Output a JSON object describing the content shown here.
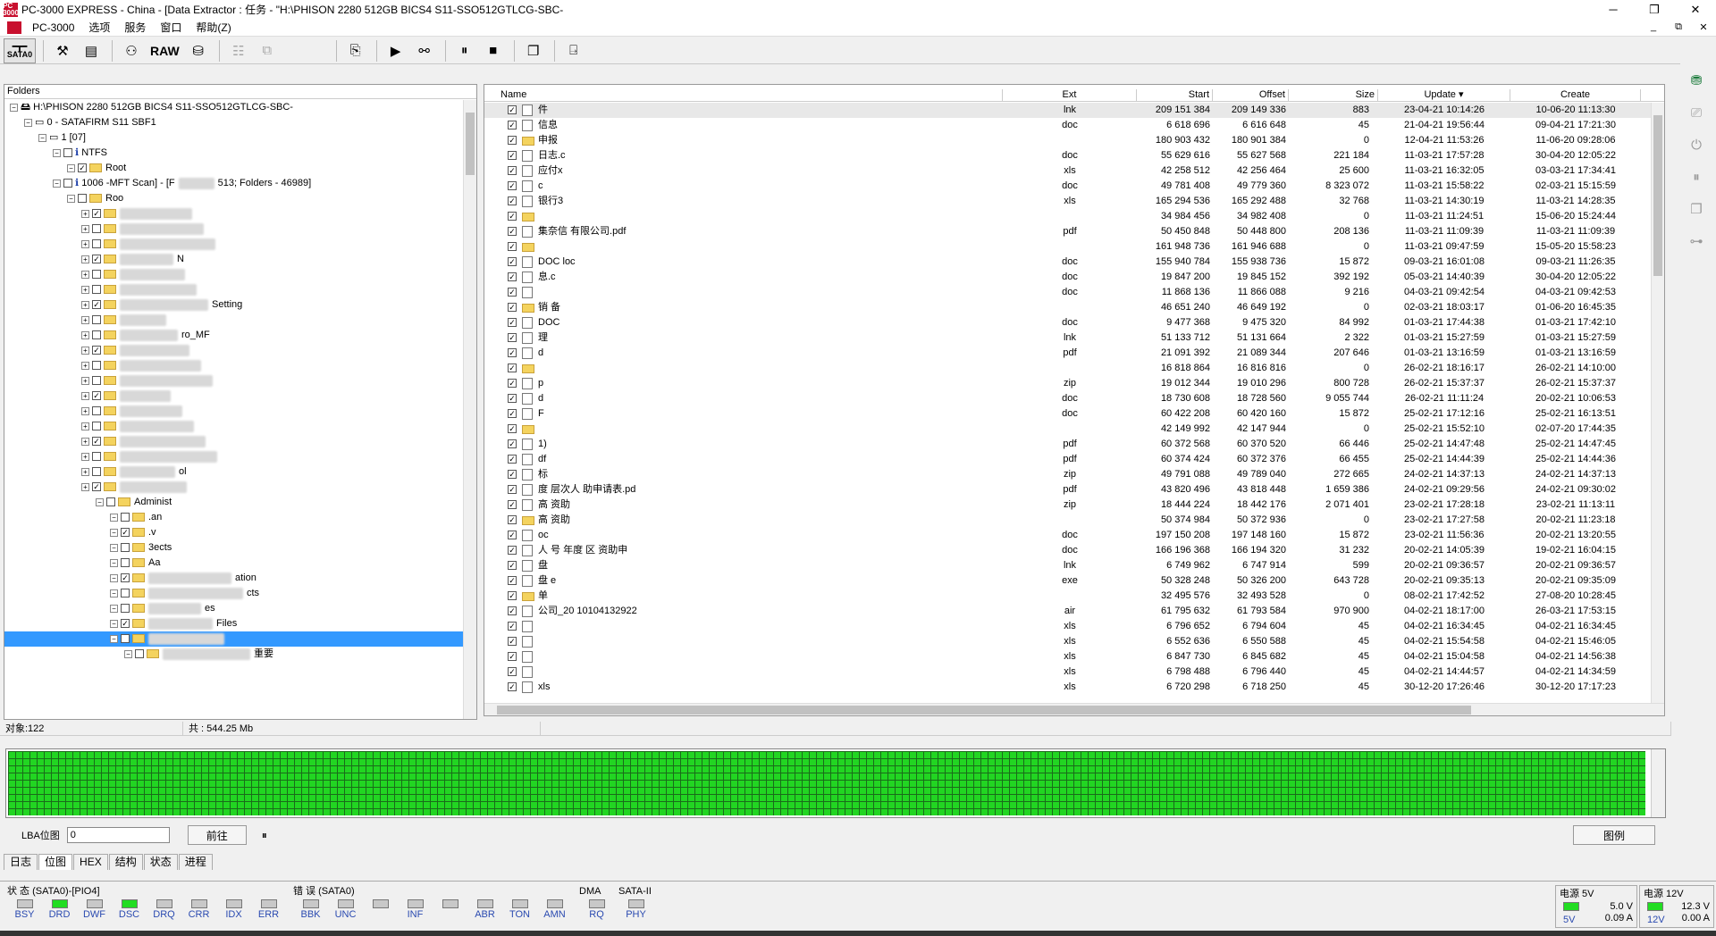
{
  "window": {
    "logo_text": "PC 3000",
    "title": "PC-3000 EXPRESS - China - [Data Extractor : 任务 - \"H:\\PHISON 2280 512GB BICS4 S11-SSO512GTLCG-SBC-",
    "minimize": "─",
    "maximize": "❐",
    "close": "✕"
  },
  "menu": {
    "items": [
      "PC-3000",
      "选项",
      "服务",
      "窗口",
      "帮助(Z)"
    ],
    "mdi_controls": [
      "_",
      "⧉",
      "✕"
    ]
  },
  "toolbar": {
    "sata_label": "SATA0",
    "raw_label": "RAW"
  },
  "folders": {
    "header": "Folders",
    "rows": [
      {
        "text": "H:\\PHISON 2280 512GB BICS4 S11-SSO512GTLCG-SBC-",
        "tail": "",
        "level": 0
      },
      {
        "text": "0 - SATAFIRM   S11 SBF",
        "tail": "1",
        "level": 1
      },
      {
        "text": "1 [07]",
        "tail": "",
        "level": 2
      },
      {
        "text": "NTFS",
        "tail": "",
        "level": 3
      },
      {
        "text": "Root",
        "tail": "",
        "level": 4
      },
      {
        "text": "1006 -",
        "tail": "MFT Scan] - [F",
        "tail2": "513; Folders - 46989]",
        "level": 3
      },
      {
        "text": "Roo",
        "tail": "",
        "level": 4
      },
      {
        "text": "",
        "tail": "",
        "level": 5
      },
      {
        "text": "",
        "tail": "",
        "level": 5
      },
      {
        "text": "",
        "tail": "",
        "level": 5
      },
      {
        "text": "",
        "tail": "N",
        "level": 5
      },
      {
        "text": "",
        "tail": "",
        "level": 5
      },
      {
        "text": "",
        "tail": "",
        "level": 5
      },
      {
        "text": "",
        "tail": "Setting",
        "level": 5
      },
      {
        "text": "",
        "tail": "",
        "level": 5
      },
      {
        "text": "",
        "tail": "ro_MF",
        "level": 5
      },
      {
        "text": "",
        "tail": "",
        "level": 5
      },
      {
        "text": "",
        "tail": "",
        "level": 5
      },
      {
        "text": "",
        "tail": "",
        "level": 5
      },
      {
        "text": "",
        "tail": "",
        "level": 5
      },
      {
        "text": "",
        "tail": "",
        "level": 5
      },
      {
        "text": "",
        "tail": "",
        "level": 5
      },
      {
        "text": "",
        "tail": "",
        "level": 5
      },
      {
        "text": "",
        "tail": "",
        "level": 5
      },
      {
        "text": "",
        "tail": "ol",
        "level": 5
      },
      {
        "text": "",
        "tail": "",
        "level": 5
      },
      {
        "text": "Administ",
        "tail": "",
        "level": 6
      },
      {
        "text": ".an",
        "tail": "",
        "level": 7
      },
      {
        "text": ".v",
        "tail": "",
        "level": 7
      },
      {
        "text": "3",
        "tail": "ects",
        "level": 7
      },
      {
        "text": "A",
        "tail": "a",
        "level": 7
      },
      {
        "text": "",
        "tail": "ation",
        "level": 7
      },
      {
        "text": "",
        "tail": "cts",
        "level": 7
      },
      {
        "text": "",
        "tail": "es",
        "level": 7
      },
      {
        "text": "",
        "tail": "Files",
        "level": 7
      },
      {
        "text": "",
        "tail": "",
        "level": 7,
        "selected": true
      },
      {
        "text": "",
        "tail": "重要",
        "level": 8
      }
    ]
  },
  "filelist": {
    "columns": [
      "Name",
      "Ext",
      "Start",
      "Offset",
      "Size",
      "Update",
      "Create"
    ],
    "rows": [
      {
        "name": "件",
        "ext": "lnk",
        "start": "209 151 384",
        "offset": "209 149 336",
        "size": "883",
        "update": "23-04-21 10:14:26",
        "create": "10-06-20 11:13:30",
        "folder": false
      },
      {
        "name": "信息",
        "ext": "doc",
        "start": "6 618 696",
        "offset": "6 616 648",
        "size": "45",
        "update": "21-04-21 19:56:44",
        "create": "09-04-21 17:21:30",
        "folder": false
      },
      {
        "name": "申报",
        "ext": "",
        "start": "180 903 432",
        "offset": "180 901 384",
        "size": "0",
        "update": "12-04-21 11:53:26",
        "create": "11-06-20 09:28:06",
        "folder": true
      },
      {
        "name": "日志.c",
        "ext": "doc",
        "start": "55 629 616",
        "offset": "55 627 568",
        "size": "221 184",
        "update": "11-03-21 17:57:28",
        "create": "30-04-20 12:05:22",
        "folder": false
      },
      {
        "name": "应付x",
        "ext": "xls",
        "start": "42 258 512",
        "offset": "42 256 464",
        "size": "25 600",
        "update": "11-03-21 16:32:05",
        "create": "03-03-21 17:34:41",
        "folder": false
      },
      {
        "name": "c",
        "ext": "doc",
        "start": "49 781 408",
        "offset": "49 779 360",
        "size": "8 323 072",
        "update": "11-03-21 15:58:22",
        "create": "02-03-21 15:15:59",
        "folder": false
      },
      {
        "name": "银行3",
        "ext": "xls",
        "start": "165 294 536",
        "offset": "165 292 488",
        "size": "32 768",
        "update": "11-03-21 14:30:19",
        "create": "11-03-21 14:28:35",
        "folder": false
      },
      {
        "name": "",
        "ext": "",
        "start": "34 984 456",
        "offset": "34 982 408",
        "size": "0",
        "update": "11-03-21 11:24:51",
        "create": "15-06-20 15:24:44",
        "folder": true
      },
      {
        "name": "集奈信        有限公司.pdf",
        "ext": "pdf",
        "start": "50 450 848",
        "offset": "50 448 800",
        "size": "208 136",
        "update": "11-03-21 11:09:39",
        "create": "11-03-21 11:09:39",
        "folder": false
      },
      {
        "name": "",
        "ext": "",
        "start": "161 948 736",
        "offset": "161 946 688",
        "size": "0",
        "update": "11-03-21 09:47:59",
        "create": "15-05-20 15:58:23",
        "folder": true
      },
      {
        "name": "DOC        loc",
        "ext": "doc",
        "start": "155 940 784",
        "offset": "155 938 736",
        "size": "15 872",
        "update": "09-03-21 16:01:08",
        "create": "09-03-21 11:26:35",
        "folder": false
      },
      {
        "name": "息.c",
        "ext": "doc",
        "start": "19 847 200",
        "offset": "19 845 152",
        "size": "392 192",
        "update": "05-03-21 14:40:39",
        "create": "30-04-20 12:05:22",
        "folder": false
      },
      {
        "name": "",
        "ext": "doc",
        "start": "11 868 136",
        "offset": "11 866 088",
        "size": "9 216",
        "update": "04-03-21 09:42:54",
        "create": "04-03-21 09:42:53",
        "folder": false
      },
      {
        "name": "销        备",
        "ext": "",
        "start": "46 651 240",
        "offset": "46 649 192",
        "size": "0",
        "update": "02-03-21 18:03:17",
        "create": "01-06-20 16:45:35",
        "folder": true
      },
      {
        "name": "DOC",
        "ext": "doc",
        "start": "9 477 368",
        "offset": "9 475 320",
        "size": "84 992",
        "update": "01-03-21 17:44:38",
        "create": "01-03-21 17:42:10",
        "folder": false
      },
      {
        "name": "理",
        "ext": "lnk",
        "start": "51 133 712",
        "offset": "51 131 664",
        "size": "2 322",
        "update": "01-03-21 15:27:59",
        "create": "01-03-21 15:27:59",
        "folder": false
      },
      {
        "name": "d",
        "ext": "pdf",
        "start": "21 091 392",
        "offset": "21 089 344",
        "size": "207 646",
        "update": "01-03-21 13:16:59",
        "create": "01-03-21 13:16:59",
        "folder": false
      },
      {
        "name": "",
        "ext": "",
        "start": "16 818 864",
        "offset": "16 816 816",
        "size": "0",
        "update": "26-02-21 18:16:17",
        "create": "26-02-21 14:10:00",
        "folder": true
      },
      {
        "name": "p",
        "ext": "zip",
        "start": "19 012 344",
        "offset": "19 010 296",
        "size": "800 728",
        "update": "26-02-21 15:37:37",
        "create": "26-02-21 15:37:37",
        "folder": false
      },
      {
        "name": "d",
        "ext": "doc",
        "start": "18 730 608",
        "offset": "18 728 560",
        "size": "9 055 744",
        "update": "26-02-21 11:11:24",
        "create": "20-02-21 10:06:53",
        "folder": false
      },
      {
        "name": "F",
        "ext": "doc",
        "start": "60 422 208",
        "offset": "60 420 160",
        "size": "15 872",
        "update": "25-02-21 17:12:16",
        "create": "25-02-21 16:13:51",
        "folder": false
      },
      {
        "name": "",
        "ext": "",
        "start": "42 149 992",
        "offset": "42 147 944",
        "size": "0",
        "update": "25-02-21 15:52:10",
        "create": "02-07-20 17:44:35",
        "folder": true
      },
      {
        "name": "1)",
        "ext": "pdf",
        "start": "60 372 568",
        "offset": "60 370 520",
        "size": "66 446",
        "update": "25-02-21 14:47:48",
        "create": "25-02-21 14:47:45",
        "folder": false
      },
      {
        "name": "df",
        "ext": "pdf",
        "start": "60 374 424",
        "offset": "60 372 376",
        "size": "66 455",
        "update": "25-02-21 14:44:39",
        "create": "25-02-21 14:44:36",
        "folder": false
      },
      {
        "name": "标",
        "ext": "zip",
        "start": "49 791 088",
        "offset": "49 789 040",
        "size": "272 665",
        "update": "24-02-21 14:37:13",
        "create": "24-02-21 14:37:13",
        "folder": false
      },
      {
        "name": "度        层次人        助申请表.pd",
        "ext": "pdf",
        "start": "43 820 496",
        "offset": "43 818 448",
        "size": "1 659 386",
        "update": "24-02-21 09:29:56",
        "create": "24-02-21 09:30:02",
        "folder": false
      },
      {
        "name": "高        资助",
        "ext": "zip",
        "start": "18 444 224",
        "offset": "18 442 176",
        "size": "2 071 401",
        "update": "23-02-21 17:28:18",
        "create": "23-02-21 11:13:11",
        "folder": false
      },
      {
        "name": "高        资助",
        "ext": "",
        "start": "50 374 984",
        "offset": "50 372 936",
        "size": "0",
        "update": "23-02-21 17:27:58",
        "create": "20-02-21 11:23:18",
        "folder": true
      },
      {
        "name": "oc",
        "ext": "doc",
        "start": "197 150 208",
        "offset": "197 148 160",
        "size": "15 872",
        "update": "23-02-21 11:56:36",
        "create": "20-02-21 13:20:55",
        "folder": false
      },
      {
        "name": "人        号        年度        区        资助申",
        "ext": "doc",
        "start": "166 196 368",
        "offset": "166 194 320",
        "size": "31 232",
        "update": "20-02-21 14:05:39",
        "create": "19-02-21 16:04:15",
        "folder": false
      },
      {
        "name": "盘",
        "ext": "lnk",
        "start": "6 749 962",
        "offset": "6 747 914",
        "size": "599",
        "update": "20-02-21 09:36:57",
        "create": "20-02-21 09:36:57",
        "folder": false
      },
      {
        "name": "盘        e",
        "ext": "exe",
        "start": "50 328 248",
        "offset": "50 326 200",
        "size": "643 728",
        "update": "20-02-21 09:35:13",
        "create": "20-02-21 09:35:09",
        "folder": false
      },
      {
        "name": "单",
        "ext": "",
        "start": "32 495 576",
        "offset": "32 493 528",
        "size": "0",
        "update": "08-02-21 17:42:52",
        "create": "27-08-20 10:28:45",
        "folder": true
      },
      {
        "name": "        公司_20        10104132922",
        "ext": "air",
        "start": "61 795 632",
        "offset": "61 793 584",
        "size": "970 900",
        "update": "04-02-21 18:17:00",
        "create": "26-03-21 17:53:15",
        "folder": false
      },
      {
        "name": "",
        "ext": "xls",
        "start": "6 796 652",
        "offset": "6 794 604",
        "size": "45",
        "update": "04-02-21 16:34:45",
        "create": "04-02-21 16:34:45",
        "folder": false
      },
      {
        "name": "",
        "ext": "xls",
        "start": "6 552 636",
        "offset": "6 550 588",
        "size": "45",
        "update": "04-02-21 15:54:58",
        "create": "04-02-21 15:46:05",
        "folder": false
      },
      {
        "name": "",
        "ext": "xls",
        "start": "6 847 730",
        "offset": "6 845 682",
        "size": "45",
        "update": "04-02-21 15:04:58",
        "create": "04-02-21 14:56:38",
        "folder": false
      },
      {
        "name": "",
        "ext": "xls",
        "start": "6 798 488",
        "offset": "6 796 440",
        "size": "45",
        "update": "04-02-21 14:44:57",
        "create": "04-02-21 14:34:59",
        "folder": false
      },
      {
        "name": "xls",
        "ext": "xls",
        "start": "6 720 298",
        "offset": "6 718 250",
        "size": "45",
        "update": "30-12-20 17:26:46",
        "create": "30-12-20 17:17:23",
        "folder": false
      }
    ]
  },
  "status": {
    "objects": "对象:122",
    "total": "共 : 544.25 Mb"
  },
  "lba": {
    "label": "LBA位图",
    "value": "0",
    "go_button": "前往",
    "pause": "⏸",
    "legend_button": "图例"
  },
  "tabs": [
    "日志",
    "位图",
    "HEX",
    "结构",
    "状态",
    "进程"
  ],
  "indicators": {
    "state_title": "状 态 (SATA0)-[PIO4]",
    "state_leds": [
      {
        "label": "BSY",
        "on": false
      },
      {
        "label": "DRD",
        "on": true
      },
      {
        "label": "DWF",
        "on": false
      },
      {
        "label": "DSC",
        "on": true
      },
      {
        "label": "DRQ",
        "on": false
      },
      {
        "label": "CRR",
        "on": false
      },
      {
        "label": "IDX",
        "on": false
      },
      {
        "label": "ERR",
        "on": false
      }
    ],
    "error_title": "错 误 (SATA0)",
    "error_leds": [
      "BBK",
      "UNC",
      "",
      "INF",
      "",
      "ABR",
      "TON",
      "AMN"
    ],
    "dma_title": "DMA",
    "dma_leds": [
      "RQ"
    ],
    "sata_title": "SATA-II",
    "sata_leds": [
      "PHY"
    ],
    "power5": {
      "title": "电源 5V",
      "label": "5V",
      "volt": "5.0 V",
      "amp": "0.09 A"
    },
    "power12": {
      "title": "电源 12V",
      "label": "12V",
      "volt": "12.3 V",
      "amp": "0.00 A"
    }
  },
  "colors": {
    "selection": "#3399ff",
    "map_good": "#22d522",
    "led_on": "#22dd22",
    "led_label": "#2a4ab0"
  }
}
